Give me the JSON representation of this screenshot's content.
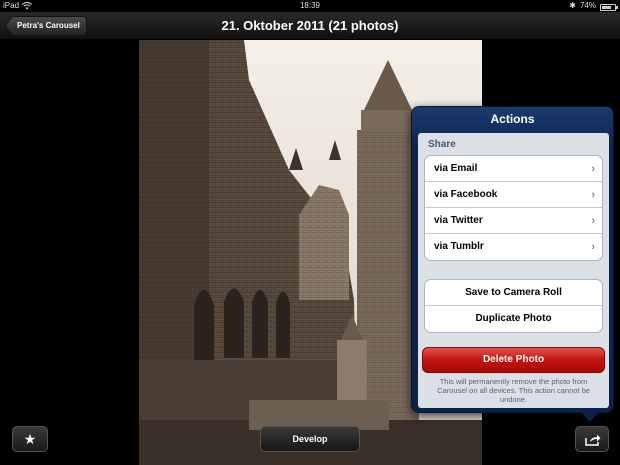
{
  "status_bar": {
    "device": "iPad",
    "time": "18:39",
    "battery": "74%",
    "battery_level": 0.74
  },
  "nav": {
    "back_label": "Petra's Carousel",
    "title": "21. Oktober 2011 (21 photos)"
  },
  "popover": {
    "title": "Actions",
    "section_header": "Share",
    "share_items": [
      {
        "label": "via Email"
      },
      {
        "label": "via Facebook"
      },
      {
        "label": "via Twitter"
      },
      {
        "label": "via Tumblr"
      }
    ],
    "action_items": [
      {
        "label": "Save to Camera Roll"
      },
      {
        "label": "Duplicate Photo"
      }
    ],
    "delete_label": "Delete Photo",
    "warning": "This will permanently remove the photo from Carousel on all devices. This action cannot be undone."
  },
  "toolbar": {
    "star_icon": "★",
    "develop_label": "Develop"
  },
  "colors": {
    "popover_bg": "#0d2550",
    "delete_red": "#c0140f",
    "photo_tint": "#8a7a6a"
  }
}
